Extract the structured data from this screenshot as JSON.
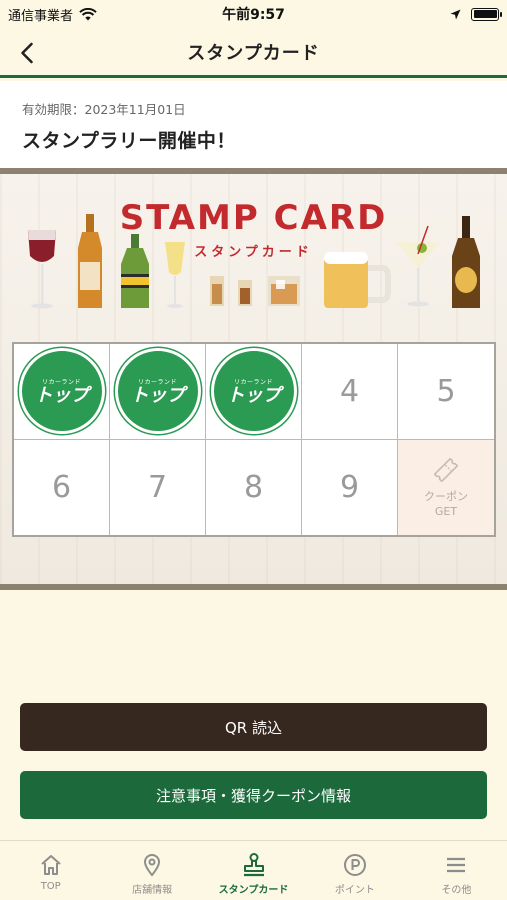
{
  "status_bar": {
    "carrier": "通信事業者",
    "time": "午前9:57"
  },
  "nav": {
    "title": "スタンプカード"
  },
  "info": {
    "expiry": "有効期限：2023年11月01日",
    "headline": "スタンプラリー開催中！"
  },
  "card": {
    "title": "STAMP CARD",
    "subtitle": "スタンプカード",
    "stamp_logo": {
      "sub": "リカーランド",
      "main": "トップ"
    },
    "stamps_collected": 3,
    "cells": [
      "",
      "",
      "",
      "4",
      "5",
      "6",
      "7",
      "8",
      "9"
    ],
    "coupon_cell": {
      "label_line1": "クーポン",
      "label_line2": "GET"
    }
  },
  "buttons": {
    "qr": "QR 読込",
    "info": "注意事項・獲得クーポン情報"
  },
  "tabs": [
    {
      "label": "TOP",
      "icon": "home-icon",
      "active": false
    },
    {
      "label": "店舗情報",
      "icon": "location-pin-icon",
      "active": false
    },
    {
      "label": "スタンプカード",
      "icon": "stamp-icon",
      "active": true
    },
    {
      "label": "ポイント",
      "icon": "point-icon",
      "active": false
    },
    {
      "label": "その他",
      "icon": "menu-icon",
      "active": false
    }
  ],
  "colors": {
    "primary_green": "#1c6a3c",
    "stamp_green": "#2b9a53",
    "dark_brown": "#36271f",
    "title_red": "#c22a2e",
    "background_cream": "#fdf8e4"
  }
}
